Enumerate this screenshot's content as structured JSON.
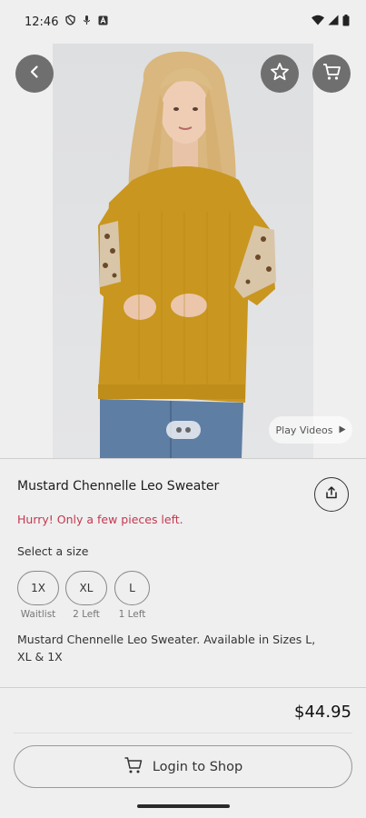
{
  "status_bar": {
    "time": "12:46",
    "icons_left": [
      "shield-icon",
      "mic-icon",
      "a-box-icon"
    ],
    "icons_right": [
      "wifi-icon",
      "signal-icon",
      "battery-icon"
    ]
  },
  "header": {
    "back_icon": "chevron-left-icon",
    "favorite_icon": "star-icon",
    "cart_icon": "cart-icon"
  },
  "gallery": {
    "page_dots": 2,
    "play_videos_label": "Play Videos"
  },
  "product": {
    "title": "Mustard Chennelle Leo Sweater",
    "urgency": "Hurry! Only a few pieces left.",
    "size_prompt": "Select a size",
    "sizes": [
      {
        "label": "1X",
        "status": "Waitlist"
      },
      {
        "label": "XL",
        "status": "2 Left"
      },
      {
        "label": "L",
        "status": "1 Left"
      }
    ],
    "description": "Mustard Chennelle Leo Sweater. Available in Sizes L, XL & 1X",
    "price": "$44.95"
  },
  "footer": {
    "login_label": "Login to Shop"
  },
  "colors": {
    "accent_red": "#c4384f",
    "sweater_mustard": "#c9961f",
    "round_button": "#6f6f6f"
  }
}
